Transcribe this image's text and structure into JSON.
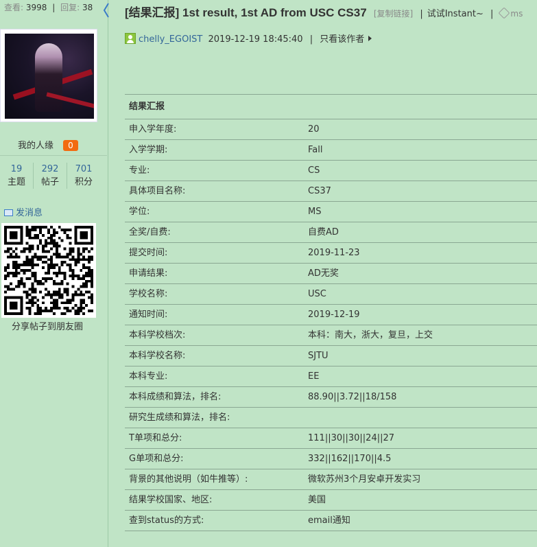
{
  "sidebar": {
    "views_label": "查看:",
    "views_value": "3998",
    "replies_label": "回复:",
    "replies_value": "38",
    "renyuan_label": "我的人缘",
    "renyuan_value": "0",
    "counts": [
      {
        "num": "19",
        "label": "主题"
      },
      {
        "num": "292",
        "label": "帖子"
      },
      {
        "num": "701",
        "label": "积分"
      }
    ],
    "send_message": "发消息",
    "share_label": "分享帖子到朋友圈"
  },
  "header": {
    "title": "[结果汇报] 1st result, 1st AD from USC CS37",
    "copy_link": "[复制链接]",
    "instant": "试试Instant~",
    "tag_text": "ms"
  },
  "post": {
    "author": "chelly_EGOIST",
    "time": "2019-12-19 18:45:40",
    "only_author": "只看该作者"
  },
  "result": {
    "heading": "结果汇报",
    "rows": [
      {
        "k": "申入学年度:",
        "v": "20"
      },
      {
        "k": "入学学期:",
        "v": "Fall"
      },
      {
        "k": "专业:",
        "v": "CS"
      },
      {
        "k": "具体项目名称:",
        "v": "CS37"
      },
      {
        "k": "学位:",
        "v": "MS"
      },
      {
        "k": "全奖/自费:",
        "v": "自费AD"
      },
      {
        "k": "提交时间:",
        "v": "2019-11-23"
      },
      {
        "k": "申请结果:",
        "v": "AD无奖"
      },
      {
        "k": "学校名称:",
        "v": "USC"
      },
      {
        "k": "通知时间:",
        "v": "2019-12-19"
      },
      {
        "k": "本科学校档次:",
        "v": "本科：南大，浙大，复旦，上交"
      },
      {
        "k": "本科学校名称:",
        "v": "SJTU"
      },
      {
        "k": "本科专业:",
        "v": "EE"
      },
      {
        "k": "本科成绩和算法，排名:",
        "v": "88.90||3.72||18/158"
      },
      {
        "k": "研究生成绩和算法，排名:",
        "v": ""
      },
      {
        "k": "T单项和总分:",
        "v": "111||30||30||24||27"
      },
      {
        "k": "G单项和总分:",
        "v": "332||162||170||4.5"
      },
      {
        "k": "背景的其他说明（如牛推等）:",
        "v": "微软苏州3个月安卓开发实习"
      },
      {
        "k": "结果学校国家、地区:",
        "v": "美国"
      },
      {
        "k": "查到status的方式:",
        "v": "email通知"
      }
    ]
  }
}
